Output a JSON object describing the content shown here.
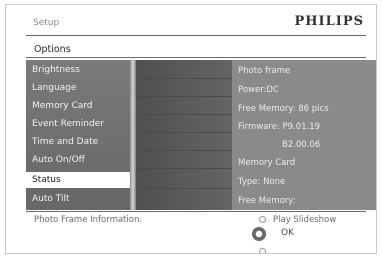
{
  "header": {
    "section": "Setup",
    "brand": "PHILIPS"
  },
  "options_title": "Options",
  "menu": {
    "items": [
      {
        "label": "Brightness"
      },
      {
        "label": "Language"
      },
      {
        "label": "Memory Card"
      },
      {
        "label": "Event Reminder"
      },
      {
        "label": "Time and Date"
      },
      {
        "label": "Auto On/Off"
      },
      {
        "label": "Status"
      },
      {
        "label": "Auto  Tilt"
      }
    ],
    "selected_index": 6
  },
  "info": {
    "lines": [
      "Photo frame",
      "Power:DC",
      "Free Memory:   86  pics",
      "Firmware:  P9.01.19",
      "B2.00.06",
      "Memory Card",
      "Type: None",
      "Free Memory:"
    ]
  },
  "footer": {
    "description": "Photo Frame Information.",
    "play_label": "Play  Slideshow",
    "ok_label": "OK"
  }
}
